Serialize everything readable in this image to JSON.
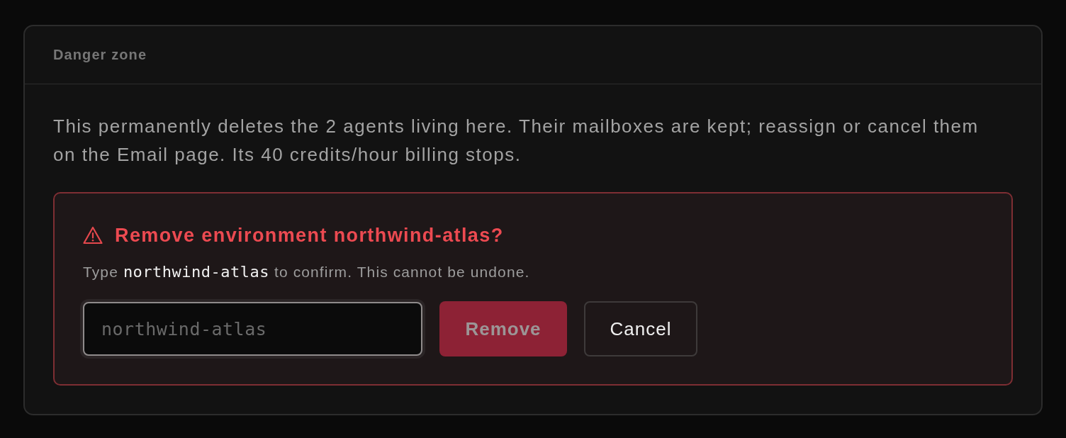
{
  "section": {
    "title": "Danger zone"
  },
  "description": "This permanently deletes the 2 agents living here. Their mailboxes are kept; reassign or cancel them on the Email page. Its 40 credits/hour billing stops.",
  "confirm": {
    "title": "Remove environment northwind-atlas?",
    "instruction": [
      {
        "kind": "plain",
        "text": "Type "
      },
      {
        "kind": "code",
        "text": "northwind-atlas"
      },
      {
        "kind": "plain",
        "text": " to confirm. This cannot be undone."
      }
    ],
    "input": {
      "placeholder": "northwind-atlas",
      "focused": true
    },
    "buttons": [
      {
        "label": "Remove",
        "kind": "danger",
        "disabled": true
      },
      {
        "label": "Cancel",
        "kind": "secondary",
        "disabled": false
      }
    ]
  }
}
